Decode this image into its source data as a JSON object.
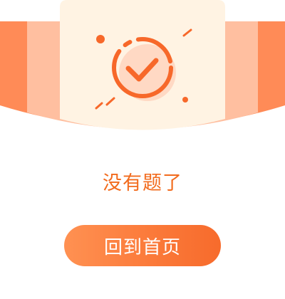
{
  "empty_state": {
    "message": "没有题了",
    "home_button_label": "回到首页"
  },
  "icons": {
    "illustration": "check-circle-icon"
  },
  "colors": {
    "accent": "#f26b1d",
    "band_dark": "#ff8b57",
    "band_light": "#ffbfa0",
    "card_bg": "#fff3e3",
    "icon_stroke": "#f7682a",
    "icon_fill": "#ffd9c4"
  }
}
